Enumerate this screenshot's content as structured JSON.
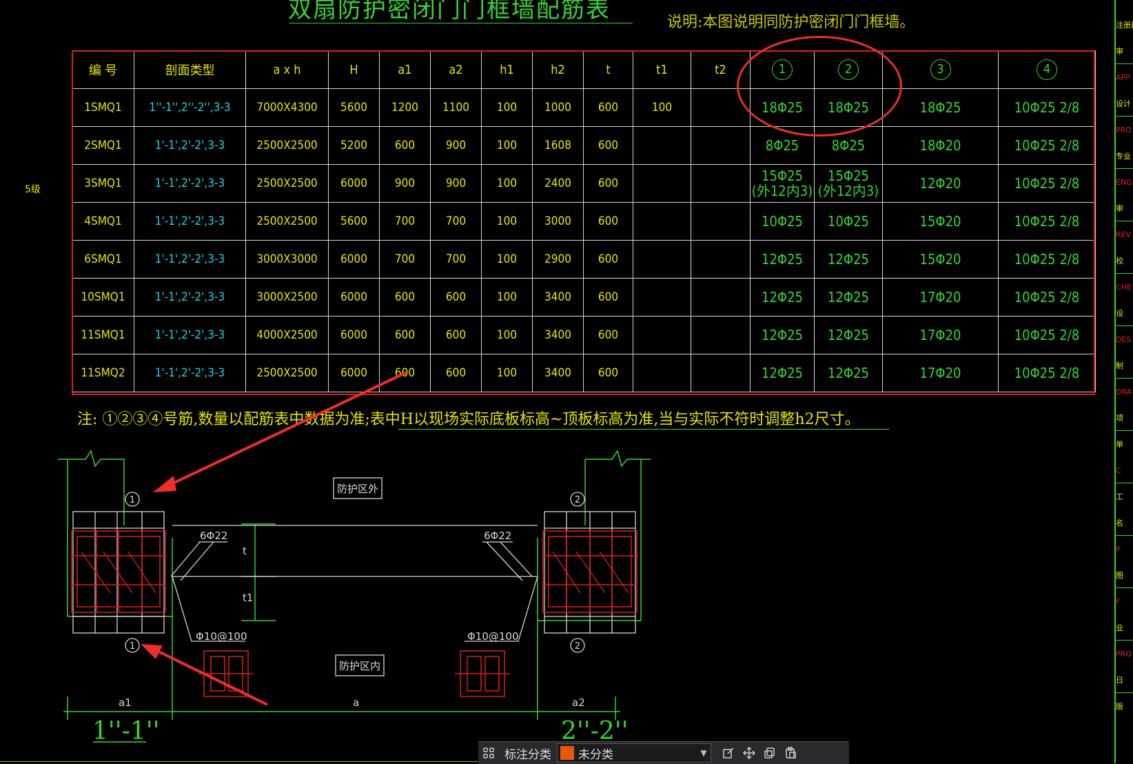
{
  "title": "双扇防护密闭门门框墙配筋表",
  "description": "说明:本图说明同防护密闭门门框墙。",
  "side_tag": "5级",
  "table": {
    "headers": [
      "编  号",
      "剖面类型",
      "a x h",
      "H",
      "a1",
      "a2",
      "h1",
      "h2",
      "t",
      "t1",
      "t2",
      "1",
      "2",
      "3",
      "4"
    ],
    "rows": [
      [
        "1SMQ1",
        "1''-1'',2''-2'',3-3",
        "7000X4300",
        "5600",
        "1200",
        "1100",
        "100",
        "1000",
        "600",
        "100",
        "",
        "18Φ25",
        "18Φ25",
        "18Φ25",
        "10Φ25 2/8"
      ],
      [
        "2SMQ1",
        "1'-1',2'-2',3-3",
        "2500X2500",
        "5200",
        "600",
        "900",
        "100",
        "1608",
        "600",
        "",
        "",
        "8Φ25",
        "8Φ25",
        "18Φ20",
        "10Φ25 2/8"
      ],
      [
        "3SMQ1",
        "1'-1',2'-2',3-3",
        "2500X2500",
        "6000",
        "900",
        "900",
        "100",
        "2400",
        "600",
        "",
        "",
        "15Φ25\n(外12内3)",
        "15Φ25\n(外12内3)",
        "12Φ20",
        "10Φ25 2/8"
      ],
      [
        "4SMQ1",
        "1'-1',2'-2',3-3",
        "2500X2500",
        "5600",
        "700",
        "700",
        "100",
        "3000",
        "600",
        "",
        "",
        "10Φ25",
        "10Φ25",
        "15Φ20",
        "10Φ25 2/8"
      ],
      [
        "6SMQ1",
        "1'-1',2'-2',3-3",
        "3000X3000",
        "6000",
        "700",
        "700",
        "100",
        "2900",
        "600",
        "",
        "",
        "12Φ25",
        "12Φ25",
        "15Φ20",
        "10Φ25 2/8"
      ],
      [
        "10SMQ1",
        "1'-1',2'-2',3-3",
        "3000X2500",
        "6000",
        "600",
        "600",
        "100",
        "3400",
        "600",
        "",
        "",
        "12Φ25",
        "12Φ25",
        "17Φ20",
        "10Φ25 2/8"
      ],
      [
        "11SMQ1",
        "1'-1',2'-2',3-3",
        "4000X2500",
        "6000",
        "600",
        "600",
        "100",
        "3400",
        "600",
        "",
        "",
        "12Φ25",
        "12Φ25",
        "17Φ20",
        "10Φ25 2/8"
      ],
      [
        "11SMQ2",
        "1'-1',2'-2',3-3",
        "2500X2500",
        "6000",
        "600",
        "600",
        "100",
        "3400",
        "600",
        "",
        "",
        "12Φ25",
        "12Φ25",
        "17Φ20",
        "10Φ25 2/8"
      ]
    ]
  },
  "note": "注:  ①②③④号筋,数量以配筋表中数据为准;表中H以现场实际底板标高~顶板标高为准,当与实际不符时调整h2尺寸。",
  "drawing": {
    "outer_label": "防护区外",
    "inner_label": "防护区内",
    "bar_left": "6Φ22",
    "bar_right": "6Φ22",
    "stirrup_left": "Φ10@100",
    "stirrup_right": "Φ10@100",
    "dim_a1": "a1",
    "dim_a": "a",
    "dim_a2": "a2",
    "dim_t": "t",
    "dim_t1": "t1",
    "marker_1": "1",
    "marker_2": "2",
    "section_left": "1''-1''",
    "section_right": "2''-2''"
  },
  "toolbar": {
    "label": "标注分类",
    "selected": "未分类",
    "swatch_color": "#e8580c"
  },
  "title_block": [
    "注册建",
    "审",
    "APP",
    "设计",
    "PRO",
    "专业",
    "ENG",
    "审",
    "REV",
    "校",
    "CHE",
    "设",
    "DES",
    "制",
    "DRA",
    "项",
    "单",
    "C",
    "工",
    "名",
    "P",
    "图",
    "F",
    "业",
    "PRO",
    "日",
    "版"
  ],
  "colors": {
    "green": "#38d338",
    "yellow": "#e6e600",
    "cyan": "#19d7e6",
    "red": "#e01e1e",
    "white": "#d8d8d8"
  }
}
